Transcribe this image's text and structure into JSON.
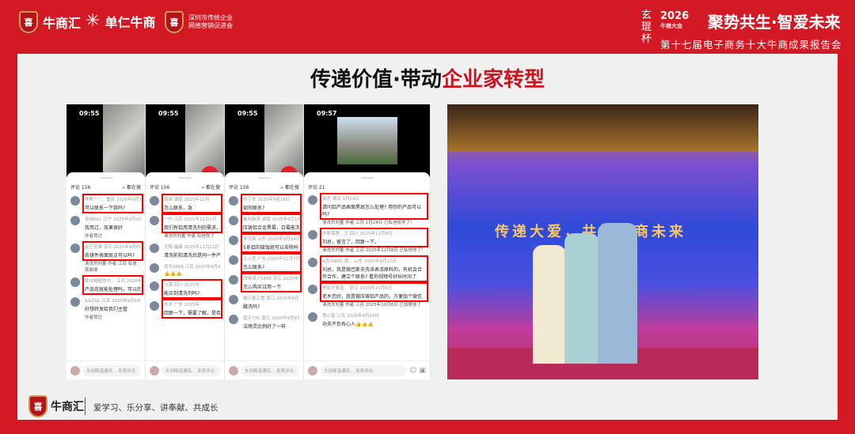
{
  "header": {
    "logos": [
      {
        "name": "牛商汇"
      },
      {
        "name": "单仁牛商"
      },
      {
        "name": "深圳市传统企业",
        "name2": "网络营销促进会"
      }
    ],
    "event": {
      "vertical": "玄琨杯",
      "year": "2026",
      "year_sub": "牛商大会",
      "slogan": "聚势共生·智爱未来",
      "subtitle": "第十七届电子商务十大牛商成果报告会"
    }
  },
  "title": {
    "part1": "传递价值·带动",
    "part2": "企业家转型"
  },
  "phones": [
    {
      "time": "09:55",
      "count": "评论 156",
      "search": "都在搜",
      "input": "车间降温通风...",
      "post": "发表评论:",
      "comments": [
        {
          "meta": "熊熊^^... 重庆 2025年9月15日",
          "text": "可以联系一下我吗?",
          "hl": true
        },
        {
          "meta": "吴伟681 辽宁 2025年9月10日",
          "text": "我用过，效果很好",
          "reply": "作者赞过"
        },
        {
          "meta": "金亿佳弹 浙江 2025年9月8日",
          "text": "去镁件表面斑点可以吗?",
          "hl": true,
          "reply": "清洗剂刘董 作者 江苏  私信我谢谢"
        },
        {
          "meta": "铁中超超的中... 江苏 2025年",
          "text": "产品花斑能处理吗，可以的话，",
          "hl": true
        },
        {
          "meta": "&&ZGL 江苏 2025年9月16日",
          "text": "好想转发给我们主管",
          "reply": "作者赞过"
        }
      ]
    },
    {
      "time": "09:55",
      "count": "评论 156",
      "search": "都在搜",
      "input": "车间降温通风...",
      "post": "发表评论:",
      "comments": [
        {
          "meta": "南商 湖南 2025年11月",
          "text": "怎么联系，急",
          "hl": true
        },
        {
          "meta": "一叶 江苏 2025年11月2日",
          "text": "我们有铝用清洗剂的需求，联系",
          "hl": true,
          "reply": "清洗剂刘董 作者  私信你了"
        },
        {
          "meta": "无悔 福建 2025年11月22日",
          "text": "清洗前和清洗后是同一件产品吗"
        },
        {
          "meta": "吴平4856 江苏 2025年9月9日",
          "text": "👍👍👍"
        },
        {
          "meta": "沙漠 四川 2025年",
          "text": "能买到清洗剂吗?",
          "hl": true
        },
        {
          "meta": "木木 广东 2025年",
          "text": "回复一下，需要了解，是否清洗",
          "hl": true
        }
      ]
    },
    {
      "time": "09:55",
      "count": "评论 156",
      "search": "都在搜",
      "input": "车间降温通风...",
      "post": "发表评论:",
      "comments": [
        {
          "meta": "刘丁东 2025年9月18日",
          "text": "如何联系?",
          "hl": true
        },
        {
          "meta": "乘风破浪 湖南 2025年9月14日",
          "text": "压铸铝合金黑霉，白霉能洗掉吗",
          "hl": true
        },
        {
          "meta": "李文辉 山东 2025年9月14日",
          "text": "5系铝的腐蚀斑可以去除吗",
          "hl": true
        },
        {
          "meta": "上上签 广东 2025年11月7日",
          "text": "怎么联系?",
          "hl": true
        },
        {
          "meta": "西域浪人5468 浙江 2025年10",
          "text": "怎么购买试用一下",
          "hl": true
        },
        {
          "meta": "独行客江雪 浙江 2025年9月10日",
          "text": "酸洗吗?"
        },
        {
          "meta": "蓝天730 浙江 2025年9月9日",
          "text": "洁丽灵比例好了一样"
        }
      ]
    },
    {
      "time": "09:57",
      "count": "评论 21",
      "input": "车间降温通风...",
      "post": "发表评论:",
      "comments": [
        {
          "meta": "英杰 湖北 1月24日",
          "text": "请问铝产品表面黑斑怎么处理? 用你的产品可以吗?",
          "hl": true,
          "reply": "清洗剂刘董 作者 江苏 1月24日  已私信给你了!"
        },
        {
          "meta": "中原佰里、王 四川 2025年12月8日",
          "text": "刘总，留言了，回复一下。",
          "hl": true,
          "reply": "清洗剂刘董 作者 江苏 2025年12月8日  已私信你了!"
        },
        {
          "meta": "A苏州启化-周... 山东 2025年9月17日",
          "text": "刘总，我是做巴斯夫洗涤表活原料的，有机会合作合作，建立个联系? 看你视频号好长时间了",
          "hl": true
        },
        {
          "meta": "誉丽才俊富... 浙江 2025年10月8日",
          "text": "老乡您好，我是做压铸铝产品的，方便加个微信",
          "hl": true,
          "reply": "清洗剂刘董 作者 江苏 2025年10月8日  已加微信了"
        },
        {
          "meta": "慧心智 江苏 2025年4月24日",
          "text": "功夫不负有心人👍👍👍"
        }
      ]
    }
  ],
  "photo": {
    "banner": "传递大爱，共筑牛商未来"
  },
  "footer": {
    "logo": "牛商汇",
    "motto": "爱学习、乐分享、讲奉献、共成长"
  }
}
